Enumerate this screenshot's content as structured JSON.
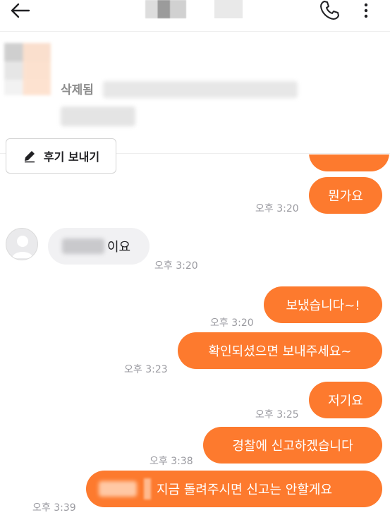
{
  "product": {
    "status": "삭제됨",
    "review_button": "후기 보내기"
  },
  "messages": [
    {
      "text": "뭔가요",
      "time": "오후 3:20"
    },
    {
      "text": "이요",
      "time": "오후 3:20"
    },
    {
      "text": "보냈습니다~!",
      "time": "오후 3:20"
    },
    {
      "text": "확인되셨으면 보내주세요~",
      "time": "오후 3:23"
    },
    {
      "text": "저기요",
      "time": "오후 3:25"
    },
    {
      "text": "경찰에 신고하겠습니다",
      "time": "오후 3:38"
    },
    {
      "text": "지금 돌려주시면 신고는 안할게요",
      "time": "오후 3:39"
    }
  ],
  "colors": {
    "outgoing_bubble": "#fd7a2e",
    "incoming_bubble": "#f1f1f3",
    "timestamp": "#9a9aa0"
  },
  "icons": [
    "back-arrow-icon",
    "phone-icon",
    "more-vertical-icon",
    "pencil-icon",
    "default-avatar-icon"
  ]
}
